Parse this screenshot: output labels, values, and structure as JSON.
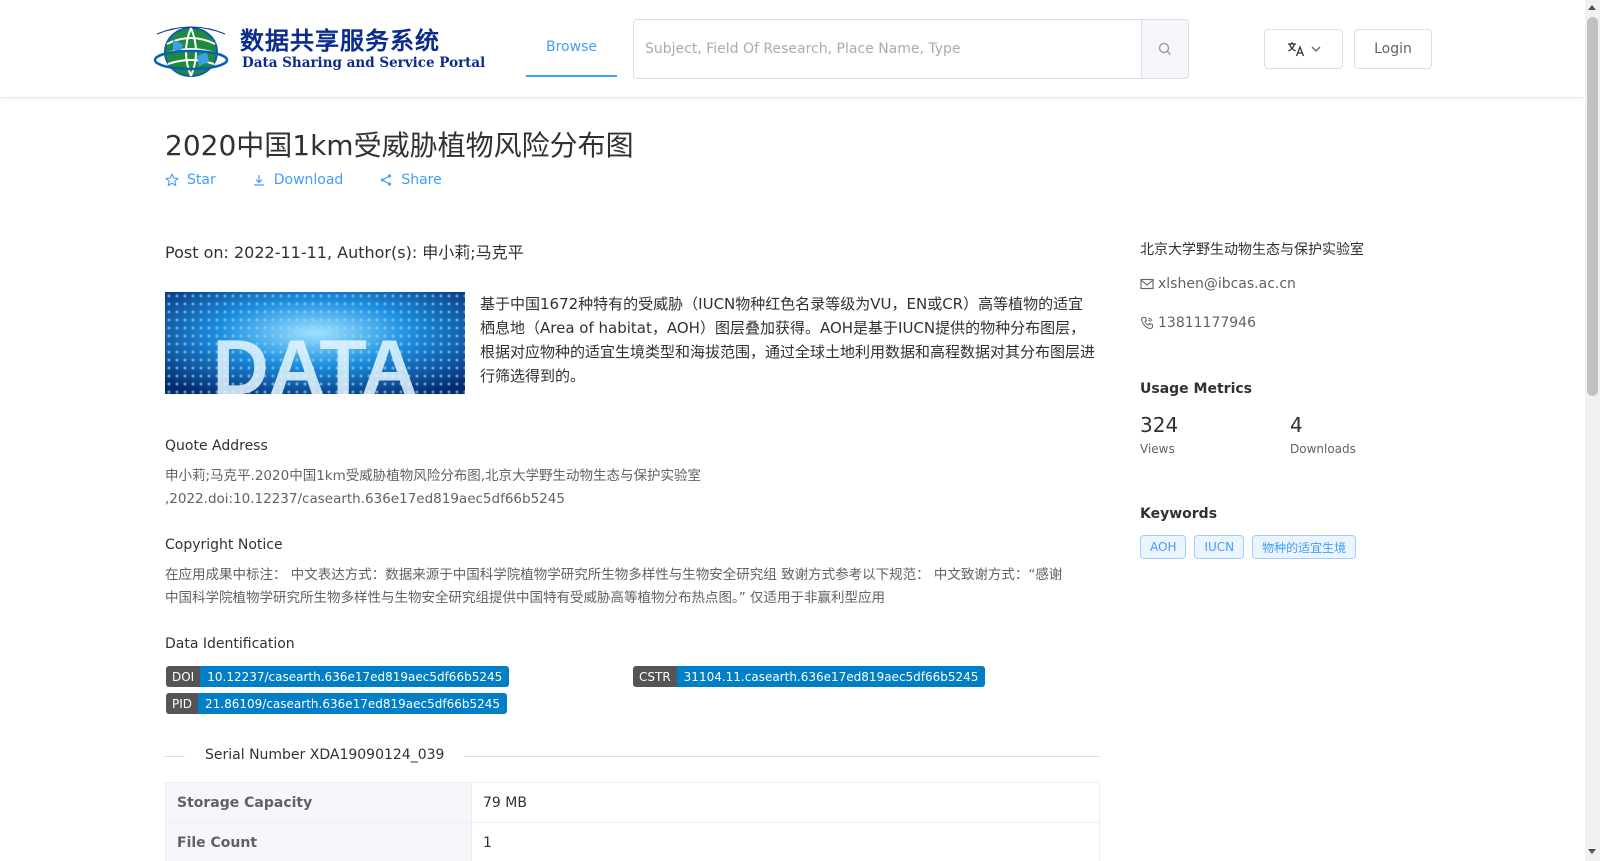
{
  "header": {
    "logo_cn": "数据共享服务系统",
    "logo_en": "Data Sharing and Service Portal",
    "nav_browse": "Browse",
    "search_placeholder": "Subject, Field Of Research, Place Name, Type",
    "login_label": "Login"
  },
  "dataset": {
    "title": "2020中国1km受威胁植物风险分布图",
    "actions": {
      "star": "Star",
      "download": "Download",
      "share": "Share"
    },
    "post_meta": "Post on: 2022-11-11, Author(s): 申小莉;马克平",
    "thumbnail_text": "DATA",
    "description": "基于中国1672种特有的受威胁（IUCN物种红色名录等级为VU，EN或CR）高等植物的适宜栖息地（Area of habitat，AOH）图层叠加获得。AOH是基于IUCN提供的物种分布图层，根据对应物种的适宜生境类型和海拔范围，通过全球土地利用数据和高程数据对其分布图层进行筛选得到的。",
    "quote": {
      "title": "Quote Address",
      "line1": "申小莉;马克平.2020中国1km受威胁植物风险分布图,北京大学野生动物生态与保护实验室",
      "line2": ",2022.doi:10.12237/casearth.636e17ed819aec5df66b5245"
    },
    "copyright": {
      "title": "Copyright Notice",
      "line1": "在应用成果中标注： 中文表达方式：数据来源于中国科学院植物学研究所生物多样性与生物安全研究组 致谢方式参考以下规范： 中文致谢方式：“感谢",
      "line2": "中国科学院植物学研究所生物多样性与生物安全研究组提供中国特有受威胁高等植物分布热点图。” 仅适用于非赢利型应用"
    },
    "identification": {
      "title": "Data Identification",
      "doi": {
        "key": "DOI",
        "value": "10.12237/casearth.636e17ed819aec5df66b5245"
      },
      "cstr": {
        "key": "CSTR",
        "value": "31104.11.casearth.636e17ed819aec5df66b5245"
      },
      "pid": {
        "key": "PID",
        "value": "21.86109/casearth.636e17ed819aec5df66b5245"
      }
    },
    "serial_number": "Serial Number XDA19090124_039",
    "table": [
      {
        "label": "Storage Capacity",
        "value": "79 MB"
      },
      {
        "label": "File Count",
        "value": "1"
      }
    ]
  },
  "sidebar": {
    "organization": "北京大学野生动物生态与保护实验室",
    "email": "xlshen@ibcas.ac.cn",
    "phone": "13811177946",
    "metrics": {
      "title": "Usage Metrics",
      "views": "324",
      "views_label": "Views",
      "downloads": "4",
      "downloads_label": "Downloads"
    },
    "keywords": {
      "title": "Keywords",
      "items": [
        "AOH",
        "IUCN",
        "物种的适宜生境"
      ]
    }
  },
  "colors": {
    "accent": "#409eff",
    "badge_key": "#555555",
    "badge_value": "#007ec6",
    "logo_blue": "#0b2c8c"
  },
  "icons": {
    "search": "search-icon",
    "translate": "translate-icon",
    "star": "star-icon",
    "download": "download-icon",
    "share": "share-icon",
    "email": "mail-icon",
    "phone": "phone-icon"
  }
}
